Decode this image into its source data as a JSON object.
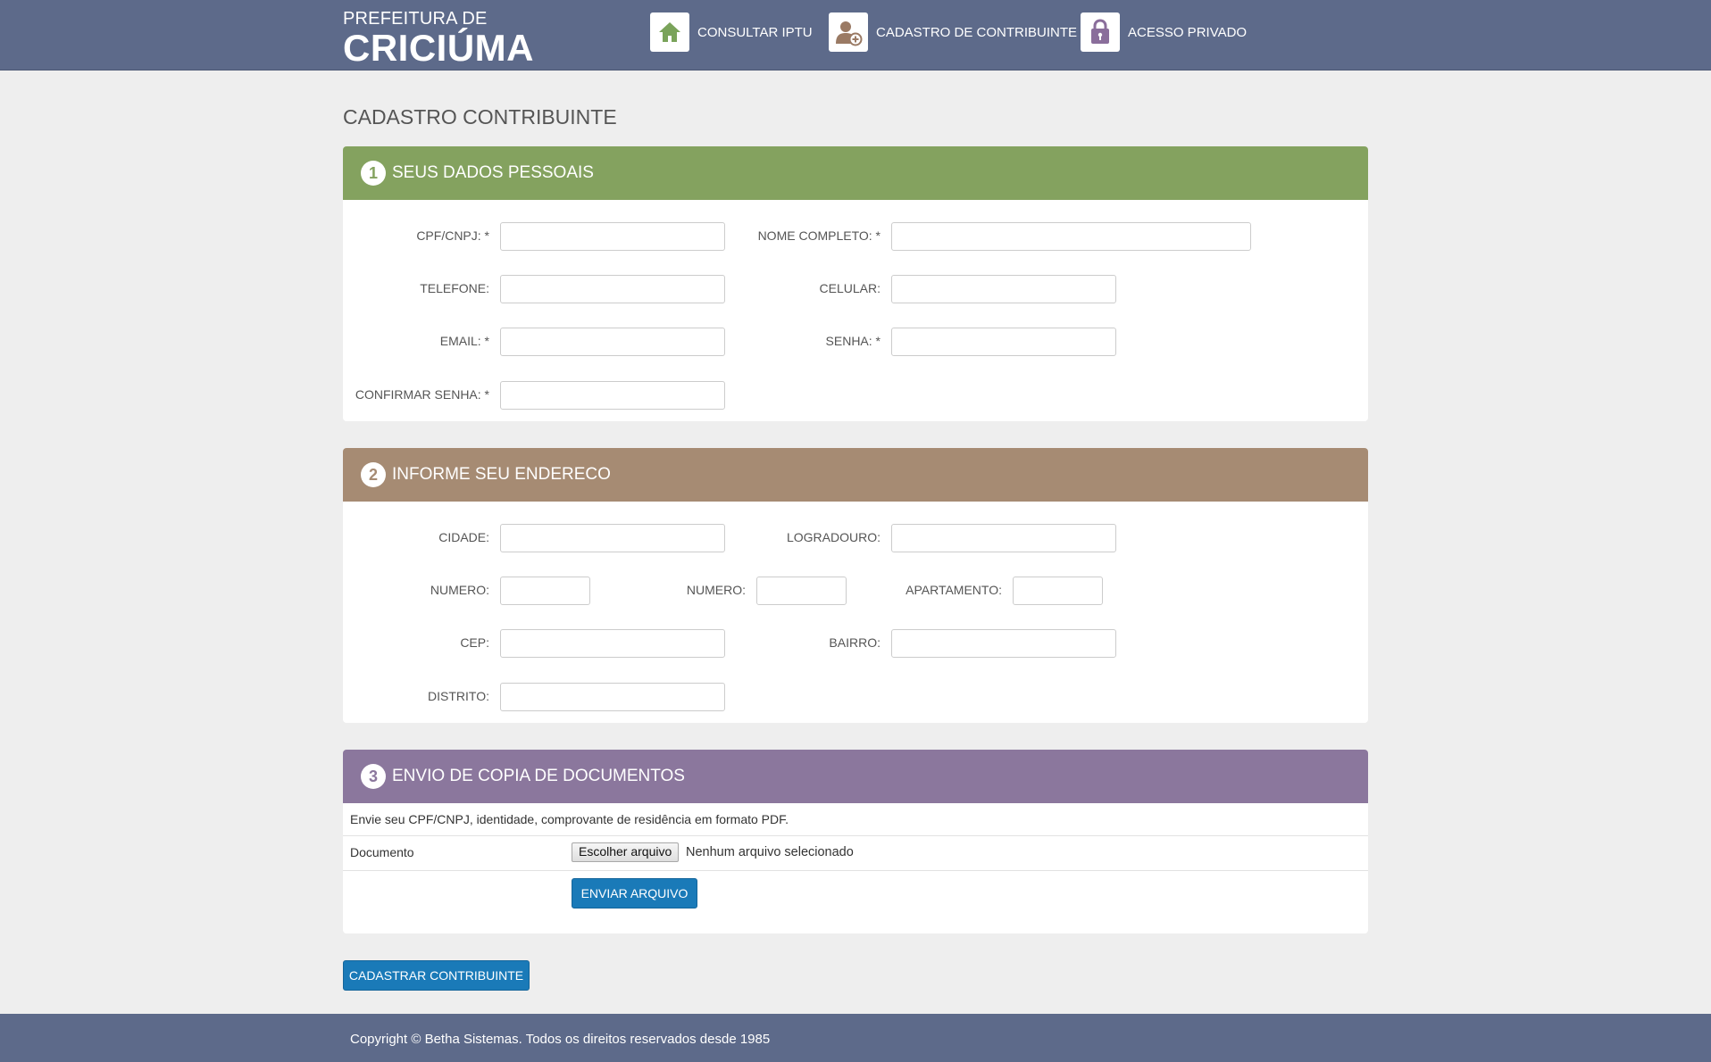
{
  "header": {
    "brand_small": "PREFEITURA DE",
    "brand_big": "CRICIÚMA",
    "nav": [
      {
        "label": "CONSULTAR IPTU",
        "icon": "home-icon",
        "color": "#7aa35a"
      },
      {
        "label": "CADASTRO DE CONTRIBUINTE",
        "icon": "add-user-icon",
        "color": "#9a7a64"
      },
      {
        "label": "ACESSO PRIVADO",
        "icon": "lock-icon",
        "color": "#8a6e9b"
      }
    ]
  },
  "page_title": "CADASTRO CONTRIBUINTE",
  "section1": {
    "number": "1",
    "title": "SEUS DADOS PESSOAIS",
    "color": "#84a25f",
    "fields": {
      "cpf": "CPF/CNPJ: *",
      "nome": "NOME COMPLETO: *",
      "telefone": "TELEFONE:",
      "celular": "CELULAR:",
      "email": "EMAIL: *",
      "senha": "SENHA: *",
      "confirmar": "CONFIRMAR SENHA: *"
    }
  },
  "section2": {
    "number": "2",
    "title": "INFORME SEU ENDERECO",
    "color": "#a68b73",
    "fields": {
      "cidade": "CIDADE:",
      "logradouro": "LOGRADOURO:",
      "numero1": "NUMERO:",
      "numero2": "NUMERO:",
      "apartamento": "APARTAMENTO:",
      "cep": "CEP:",
      "bairro": "BAIRRO:",
      "distrito": "DISTRITO:"
    }
  },
  "section3": {
    "number": "3",
    "title": "ENVIO DE COPIA DE DOCUMENTOS",
    "color": "#8b779d",
    "instructions": "Envie seu CPF/CNPJ, identidade, comprovante de residência em formato PDF.",
    "document_label": "Documento",
    "choose_file": "Escolher arquivo",
    "no_file": "Nenhum arquivo selecionado",
    "send_button": "ENVIAR ARQUIVO"
  },
  "submit_button": "CADASTRAR CONTRIBUINTE",
  "footer": "Copyright © Betha Sistemas. Todos os direitos reservados desde 1985"
}
